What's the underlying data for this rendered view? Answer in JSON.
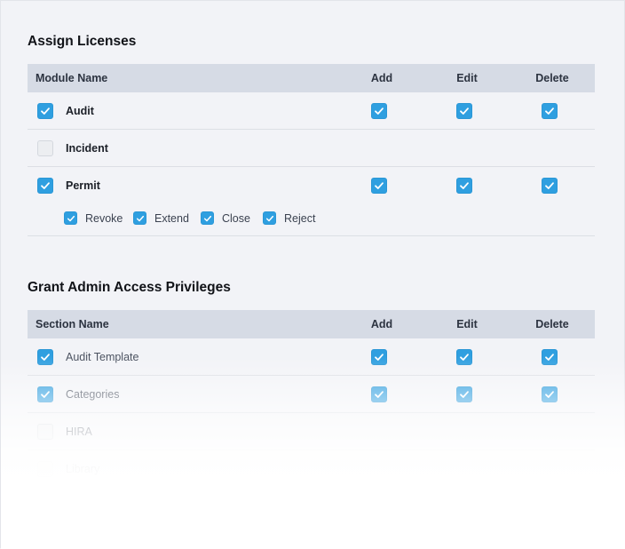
{
  "licenses": {
    "title": "Assign Licenses",
    "headers": {
      "name": "Module Name",
      "add": "Add",
      "edit": "Edit",
      "delete": "Delete"
    },
    "rows": [
      {
        "label": "Audit",
        "checked": true,
        "add": true,
        "edit": true,
        "delete": true
      },
      {
        "label": "Incident",
        "checked": false,
        "add": false,
        "edit": false,
        "delete": false
      },
      {
        "label": "Permit",
        "checked": true,
        "add": true,
        "edit": true,
        "delete": true
      }
    ],
    "permit_options": [
      {
        "label": "Revoke",
        "checked": true
      },
      {
        "label": "Extend",
        "checked": true
      },
      {
        "label": "Close",
        "checked": true
      },
      {
        "label": "Reject",
        "checked": true
      }
    ]
  },
  "admin": {
    "title": "Grant Admin Access Privileges",
    "headers": {
      "name": "Section Name",
      "add": "Add",
      "edit": "Edit",
      "delete": "Delete"
    },
    "rows": [
      {
        "label": "Audit Template",
        "checked": true,
        "add": true,
        "edit": true,
        "delete": true
      },
      {
        "label": "Categories",
        "checked": true,
        "add": true,
        "edit": true,
        "delete": true
      },
      {
        "label": "HIRA",
        "checked": false,
        "add": false,
        "edit": false,
        "delete": false
      },
      {
        "label": "Library",
        "checked": false,
        "add": false,
        "edit": false,
        "delete": false
      }
    ]
  },
  "colors": {
    "accent": "#2f9fe0",
    "header_bg": "#d6dbe5",
    "page_bg": "#f2f3f7"
  },
  "icons": {
    "checkbox_checked": "check-icon"
  }
}
